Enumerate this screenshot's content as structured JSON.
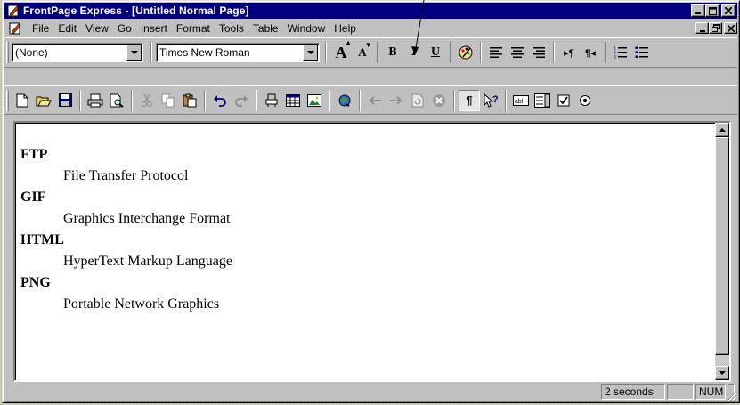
{
  "window": {
    "title": "FrontPage Express - [Untitled Normal Page]"
  },
  "menu": {
    "items": [
      {
        "label": "File"
      },
      {
        "label": "Edit"
      },
      {
        "label": "View"
      },
      {
        "label": "Go"
      },
      {
        "label": "Insert"
      },
      {
        "label": "Format"
      },
      {
        "label": "Tools"
      },
      {
        "label": "Table"
      },
      {
        "label": "Window"
      },
      {
        "label": "Help"
      }
    ]
  },
  "format_toolbar": {
    "style_value": "(None)",
    "font_value": "Times New Roman",
    "grow_font_glyph": "A",
    "shrink_font_glyph": "A",
    "bold_glyph": "B",
    "italic_glyph": "I",
    "underline_glyph": "U",
    "icons": [
      "increase-font-icon",
      "decrease-font-icon",
      "bold-icon",
      "italic-icon",
      "underline-icon",
      "text-color-icon",
      "align-left-icon",
      "align-center-icon",
      "align-right-icon",
      "increase-indent-icon",
      "decrease-indent-icon",
      "numbered-list-icon",
      "bulleted-list-icon"
    ]
  },
  "standard_toolbar": {
    "icons": [
      "new-page-icon",
      "open-icon",
      "save-icon",
      "print-icon",
      "print-preview-icon",
      "cut-icon",
      "copy-icon",
      "paste-icon",
      "undo-icon",
      "redo-icon",
      "web-bot-icon",
      "insert-table-icon",
      "insert-image-icon",
      "hyperlink-icon",
      "back-icon",
      "forward-icon",
      "refresh-icon",
      "stop-icon",
      "show-paragraph-marks-icon",
      "help-pointer-icon",
      "text-box-icon",
      "scrolling-text-box-icon",
      "checkbox-icon",
      "radio-button-icon"
    ]
  },
  "document": {
    "entries": [
      {
        "term": "FTP",
        "definition": "File Transfer Protocol"
      },
      {
        "term": "GIF",
        "definition": "Graphics Interchange Format"
      },
      {
        "term": "HTML",
        "definition": "HyperText Markup Language"
      },
      {
        "term": "PNG",
        "definition": "Portable Network Graphics"
      }
    ]
  },
  "status": {
    "load_time": "2 seconds",
    "num_lock": "NUM"
  },
  "colors": {
    "titlebar": "#000080",
    "face": "#c0c0c0",
    "desktop": "#c9c9ab"
  }
}
